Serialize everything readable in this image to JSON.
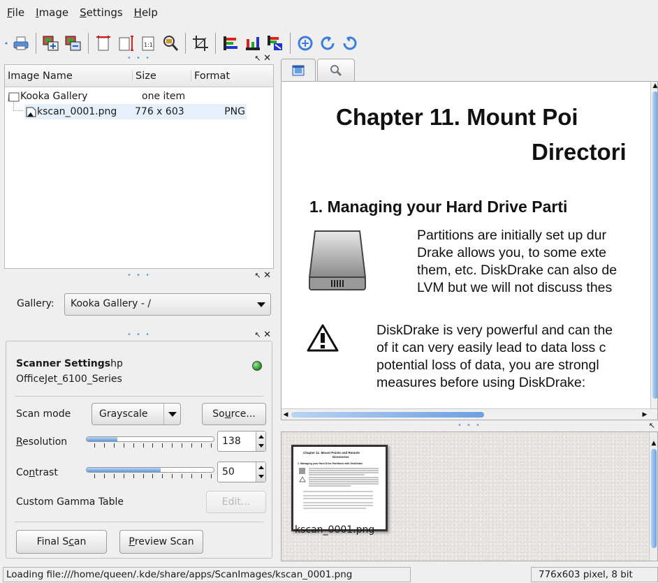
{
  "menubar": {
    "items": [
      {
        "pre": "",
        "u": "F",
        "post": "ile"
      },
      {
        "pre": "",
        "u": "I",
        "post": "mage"
      },
      {
        "pre": "",
        "u": "S",
        "post": "ettings"
      },
      {
        "pre": "",
        "u": "H",
        "post": "elp"
      }
    ]
  },
  "toolbar": {
    "icons": [
      "print-icon",
      "scan-to-gallery-icon",
      "save-ocr-icon",
      "fit-width-icon",
      "fit-height-icon",
      "original-size-icon",
      "keep-zoom-icon",
      "crop-icon",
      "mirror-vertical-icon",
      "mirror-horizontal-icon",
      "mirror-both-icon",
      "rotate-cw-icon",
      "rotate-ccw-icon",
      "rotate-180-icon"
    ]
  },
  "gallery_tree": {
    "headers": {
      "name": "Image Name",
      "size": "Size",
      "format": "Format"
    },
    "root": {
      "name": "Kooka Gallery",
      "size": "one item",
      "format": ""
    },
    "child": {
      "name": "kscan_0001.png",
      "size": "776 x 603",
      "format": "PNG"
    }
  },
  "gallery_selector": {
    "label": "Gallery:",
    "value": "Kooka Gallery - /"
  },
  "scanner": {
    "title": "Scanner Settings",
    "device_first": "hp",
    "device_second": "OfficeJet_6100_Series",
    "status_color": "#2e9e2e",
    "scan_mode_label": "Scan mode",
    "scan_mode_value": "Grayscale",
    "source_btn": {
      "pre": "So",
      "u": "u",
      "post": "rce..."
    },
    "resolution": {
      "pre": "",
      "u": "R",
      "post": "esolution",
      "value": "138",
      "level": 0.24
    },
    "contrast": {
      "pre": "Co",
      "u": "n",
      "post": "trast",
      "value": "50",
      "level": 0.58
    },
    "gamma_label": "Custom Gamma Table",
    "edit_btn": "Edit...",
    "final_scan": {
      "pre": "Final S",
      "u": "c",
      "post": "an"
    },
    "preview_scan": {
      "pre": "",
      "u": "P",
      "post": "review Scan"
    }
  },
  "viewer": {
    "tabs": [
      "image-viewer-tab-icon",
      "search-tab-icon"
    ],
    "doc_title_1": "Chapter 11. Mount Poi",
    "doc_title_2": "Directori",
    "section": "1. Managing your Hard Drive Parti",
    "para1": [
      "Partitions are initially set up dur",
      "Drake allows you, to some exte",
      "them, etc. DiskDrake can also de",
      "LVM but we will not discuss thes"
    ],
    "para2": [
      "DiskDrake is very powerful and can the",
      "of it can very easily lead to data loss c",
      "potential loss of data, you are strongl",
      "measures before using DiskDrake:"
    ]
  },
  "thumbnail": {
    "filename": "kscan_0001.png",
    "mini_title_1": "Chapter 11. Mount Points and Remote",
    "mini_title_2": "Directories",
    "mini_section": "1. Managing your Hard Drive Partitions with DiskDrake"
  },
  "statusbar": {
    "left": "Loading file:///home/queen/.kde/share/apps/ScanImages/kscan_0001.png",
    "right": "776x603 pixel, 8 bit"
  },
  "colors": {
    "accent": "#3b7ddc",
    "selection": "#e6f0fa",
    "led": "#2e9e2e"
  }
}
